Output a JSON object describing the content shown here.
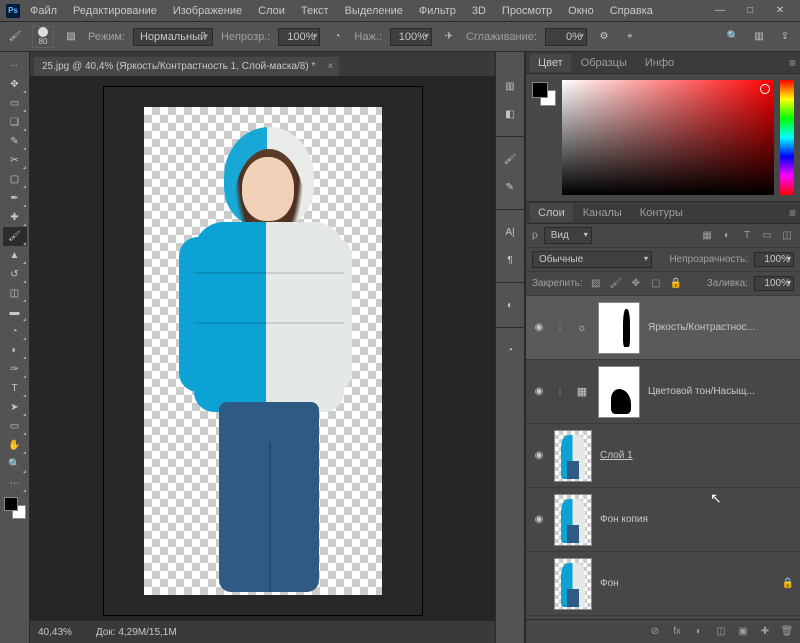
{
  "app": "Ps",
  "menu": {
    "file": "Файл",
    "edit": "Редактирование",
    "image": "Изображение",
    "layers": "Слои",
    "text": "Текст",
    "select": "Выделение",
    "filter": "Фильтр",
    "threeD": "3D",
    "view": "Просмотр",
    "window": "Окно",
    "help": "Справка"
  },
  "window_controls": {
    "min": "—",
    "max": "□",
    "close": "✕"
  },
  "options": {
    "brush_size": "80",
    "mode_label": "Режим:",
    "mode_value": "Нормальный",
    "opacity_label": "Непрозр.:",
    "opacity_value": "100%",
    "flow_label": "Наж.:",
    "flow_value": "100%",
    "smoothing_label": "Сглаживание:",
    "smoothing_value": "0%"
  },
  "doc": {
    "tab": "25.jpg @ 40,4% (Яркость/Контрастность 1, Слой-маска/8) *",
    "close": "×"
  },
  "status": {
    "zoom": "40,43%",
    "doc_label": "Док:",
    "doc_value": "4,29M/15,1M"
  },
  "tools": [
    {
      "id": "move",
      "glyph": "✥"
    },
    {
      "id": "marquee",
      "glyph": "▭"
    },
    {
      "id": "lasso",
      "glyph": "❏"
    },
    {
      "id": "quick-select",
      "glyph": "✎"
    },
    {
      "id": "crop",
      "glyph": "✂"
    },
    {
      "id": "frame",
      "glyph": "▢"
    },
    {
      "id": "eyedropper",
      "glyph": "✒"
    },
    {
      "id": "healing",
      "glyph": "✚"
    },
    {
      "id": "brush",
      "glyph": "🖌",
      "active": true
    },
    {
      "id": "stamp",
      "glyph": "▲"
    },
    {
      "id": "history-brush",
      "glyph": "↺"
    },
    {
      "id": "eraser",
      "glyph": "◫"
    },
    {
      "id": "gradient",
      "glyph": "▬"
    },
    {
      "id": "blur",
      "glyph": "◔"
    },
    {
      "id": "dodge",
      "glyph": "◐"
    },
    {
      "id": "pen",
      "glyph": "✑"
    },
    {
      "id": "type",
      "glyph": "T"
    },
    {
      "id": "path-select",
      "glyph": "➤"
    },
    {
      "id": "rectangle",
      "glyph": "▭"
    },
    {
      "id": "hand",
      "glyph": "✋"
    },
    {
      "id": "zoom",
      "glyph": "🔍"
    },
    {
      "id": "edit-toolbar",
      "glyph": "⋯"
    }
  ],
  "color_panel": {
    "tabs": {
      "color": "Цвет",
      "swatches": "Образцы",
      "info": "Инфо"
    }
  },
  "layers_panel": {
    "tabs": {
      "layers": "Слои",
      "channels": "Каналы",
      "paths": "Контуры"
    },
    "kind_label": "ρ",
    "kind_value": "Вид",
    "blend_value": "Обычные",
    "opacity_label": "Непрозрачность:",
    "opacity_value": "100%",
    "lock_label": "Закрепить:",
    "fill_label": "Заливка:",
    "fill_value": "100%",
    "layers": [
      {
        "id": "brightness",
        "name": "Яркость/Контрастнос...",
        "adj_icon": "☼",
        "mask": "mask",
        "visible": true,
        "selected": true
      },
      {
        "id": "hue",
        "name": "Цветовой тон/Насыщ...",
        "adj_icon": "▦",
        "mask": "mask2",
        "visible": true
      },
      {
        "id": "layer1",
        "name": "Слой 1",
        "mini": true,
        "visible": true,
        "underline": true
      },
      {
        "id": "bgcopy",
        "name": "Фон копия",
        "mini": true,
        "visible": true
      },
      {
        "id": "bg",
        "name": "Фон",
        "mini": true,
        "visible": false,
        "locked": true
      }
    ],
    "footer_icons": [
      "⊘",
      "fx",
      "◐",
      "◫",
      "▣",
      "✚",
      "🗑"
    ]
  }
}
